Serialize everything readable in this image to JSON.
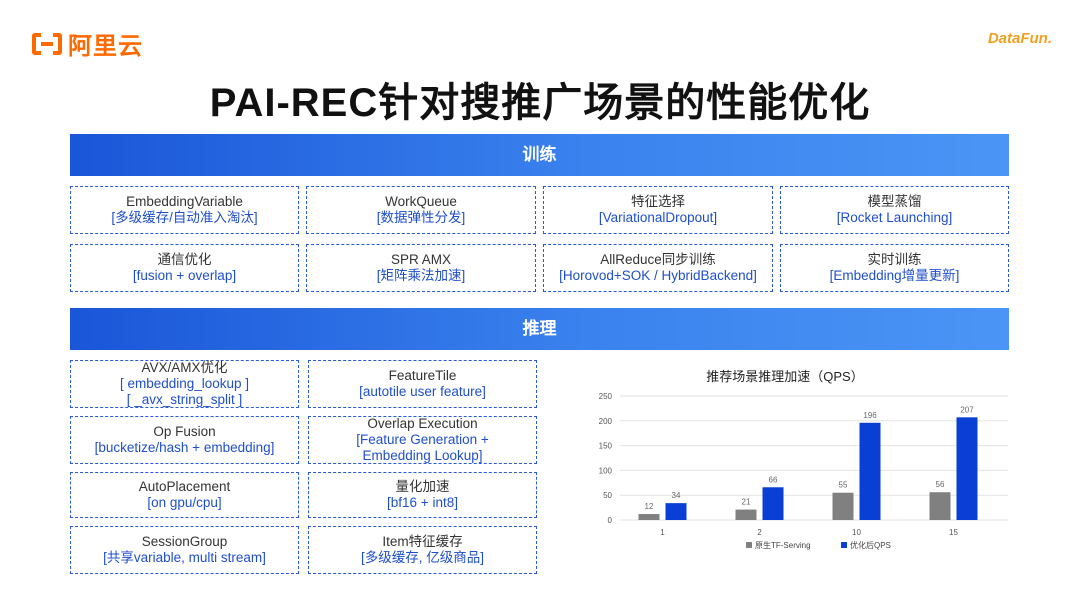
{
  "brand": {
    "aliyun": "阿里云",
    "datafun": "DataFun."
  },
  "title": "PAI-REC针对搜推广场景的性能优化",
  "training": {
    "header": "训练",
    "items": [
      {
        "name": "EmbeddingVariable",
        "desc": "[多级缓存/自动准入淘汰]"
      },
      {
        "name": "WorkQueue",
        "desc": "[数据弹性分发]"
      },
      {
        "name": "特征选择",
        "desc": "[VariationalDropout]"
      },
      {
        "name": "模型蒸馏",
        "desc": "[Rocket Launching]"
      },
      {
        "name": "通信优化",
        "desc": "[fusion + overlap]"
      },
      {
        "name": "SPR AMX",
        "desc": "[矩阵乘法加速]"
      },
      {
        "name": "AllReduce同步训练",
        "desc": "[Horovod+SOK / HybridBackend]"
      },
      {
        "name": "实时训练",
        "desc": "[Embedding增量更新]"
      }
    ]
  },
  "inference": {
    "header": "推理",
    "items": [
      {
        "name": "AVX/AMX优化",
        "desc": "[ embedding_lookup ]",
        "desc2": "[ _avx_string_split ]"
      },
      {
        "name": "FeatureTile",
        "desc": "[autotile user feature]"
      },
      {
        "name": "Op Fusion",
        "desc": "[bucketize/hash + embedding]"
      },
      {
        "name": "Overlap Execution",
        "desc": "[Feature Generation +",
        "desc2": "Embedding Lookup]"
      },
      {
        "name": "AutoPlacement",
        "desc": "[on gpu/cpu]"
      },
      {
        "name": "量化加速",
        "desc": "[bf16 + int8]"
      },
      {
        "name": "SessionGroup",
        "desc": "[共享variable, multi stream]"
      },
      {
        "name": "Item特征缓存",
        "desc": "[多级缓存, 亿级商品]"
      }
    ]
  },
  "chart_data": {
    "type": "bar",
    "title": "推荐场景推理加速（QPS）",
    "categories": [
      "1",
      "2",
      "10",
      "15"
    ],
    "series": [
      {
        "name": "原生TF-Serving",
        "values": [
          12,
          21,
          55,
          56
        ],
        "color": "#808080"
      },
      {
        "name": "优化后QPS",
        "values": [
          34,
          66,
          196,
          207
        ],
        "color": "#0a3fd6"
      }
    ],
    "ylim": [
      0,
      250
    ],
    "yticks": [
      0,
      50,
      100,
      150,
      200,
      250
    ],
    "grid": true,
    "legend": "bottom"
  }
}
